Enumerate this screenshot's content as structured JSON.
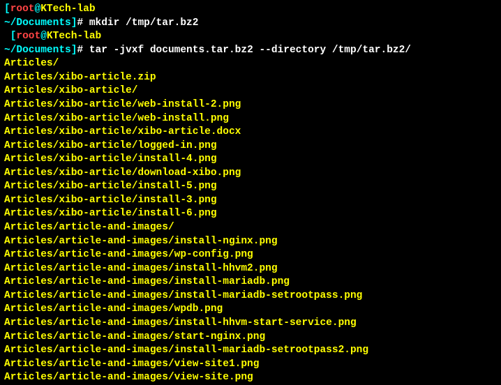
{
  "prompts": [
    {
      "open_bracket": "[",
      "user": "root",
      "at": "@",
      "host": "KTech-lab",
      "space": " ",
      "path": "~/Documents",
      "close_bracket": "]",
      "hash": "# ",
      "command": "mkdir /tmp/tar.bz2"
    },
    {
      "open_bracket": " [",
      "user": "root",
      "at": "@",
      "host": "KTech-lab",
      "space": " ",
      "path": "~/Documents",
      "close_bracket": "]",
      "hash": "# ",
      "command": "tar -jvxf documents.tar.bz2 --directory /tmp/tar.bz2/"
    }
  ],
  "output_lines": [
    "Articles/",
    "Articles/xibo-article.zip",
    "Articles/xibo-article/",
    "Articles/xibo-article/web-install-2.png",
    "Articles/xibo-article/web-install.png",
    "Articles/xibo-article/xibo-article.docx",
    "Articles/xibo-article/logged-in.png",
    "Articles/xibo-article/install-4.png",
    "Articles/xibo-article/download-xibo.png",
    "Articles/xibo-article/install-5.png",
    "Articles/xibo-article/install-3.png",
    "Articles/xibo-article/install-6.png",
    "Articles/article-and-images/",
    "Articles/article-and-images/install-nginx.png",
    "Articles/article-and-images/wp-config.png",
    "Articles/article-and-images/install-hhvm2.png",
    "Articles/article-and-images/install-mariadb.png",
    "Articles/article-and-images/install-mariadb-setrootpass.png",
    "Articles/article-and-images/wpdb.png",
    "Articles/article-and-images/install-hhvm-start-service.png",
    "Articles/article-and-images/start-nginx.png",
    "Articles/article-and-images/install-mariadb-setrootpass2.png",
    "Articles/article-and-images/view-site1.png",
    "Articles/article-and-images/view-site.png"
  ]
}
